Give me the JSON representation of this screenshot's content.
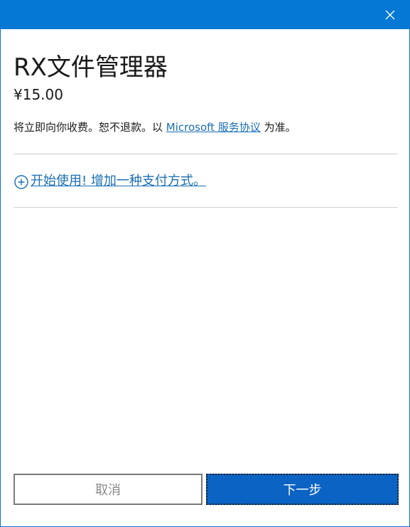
{
  "dialog": {
    "product_title": "RX文件管理器",
    "price": "¥15.00",
    "terms_prefix": "将立即向你收费。恕不退款。以 ",
    "terms_link": "Microsoft 服务协议",
    "terms_suffix": " 为准。",
    "add_payment_label": "开始使用! 增加一种支付方式。"
  },
  "buttons": {
    "cancel_label": "取消",
    "next_label": "下一步"
  },
  "icons": {
    "close": "close-icon",
    "add": "plus-circle-icon"
  },
  "colors": {
    "titlebar": "#0478d4",
    "primary_button": "#0b63c4",
    "link": "#1a6fb3"
  }
}
